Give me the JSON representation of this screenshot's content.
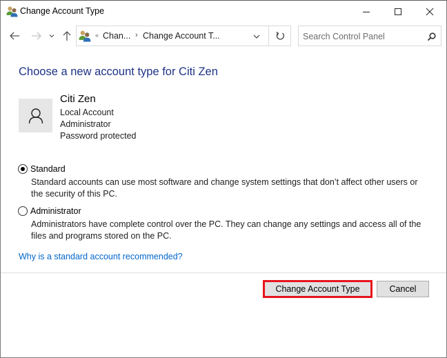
{
  "window": {
    "title": "Change Account Type",
    "controls": {
      "minimize": "minimize",
      "maximize": "maximize",
      "close": "close"
    }
  },
  "navigation": {
    "back_icon": "arrow-left-icon",
    "forward_icon": "arrow-right-icon",
    "recent_icon": "chevron-down-icon",
    "up_icon": "arrow-up-icon",
    "address": {
      "overflow": "«",
      "breadcrumbs": [
        "Chan...",
        "Change Account T..."
      ],
      "separator": "›"
    },
    "refresh_icon": "refresh-icon",
    "search": {
      "placeholder": "Search Control Panel",
      "value": ""
    }
  },
  "main": {
    "heading": "Choose a new account type for Citi Zen",
    "user": {
      "name": "Citi Zen",
      "details": [
        "Local Account",
        "Administrator",
        "Password protected"
      ]
    },
    "options": [
      {
        "label": "Standard",
        "selected": true,
        "description": "Standard accounts can use most software and change system settings that don’t affect other users or the security of this PC."
      },
      {
        "label": "Administrator",
        "selected": false,
        "description": "Administrators have complete control over the PC. They can change any settings and access all of the files and programs stored on the PC."
      }
    ],
    "help_link": "Why is a standard account recommended?"
  },
  "footer": {
    "primary_button": "Change Account Type",
    "cancel_button": "Cancel",
    "highlight_color": "#e8141c"
  },
  "colors": {
    "heading": "#1e3287",
    "link": "#0066cc"
  }
}
